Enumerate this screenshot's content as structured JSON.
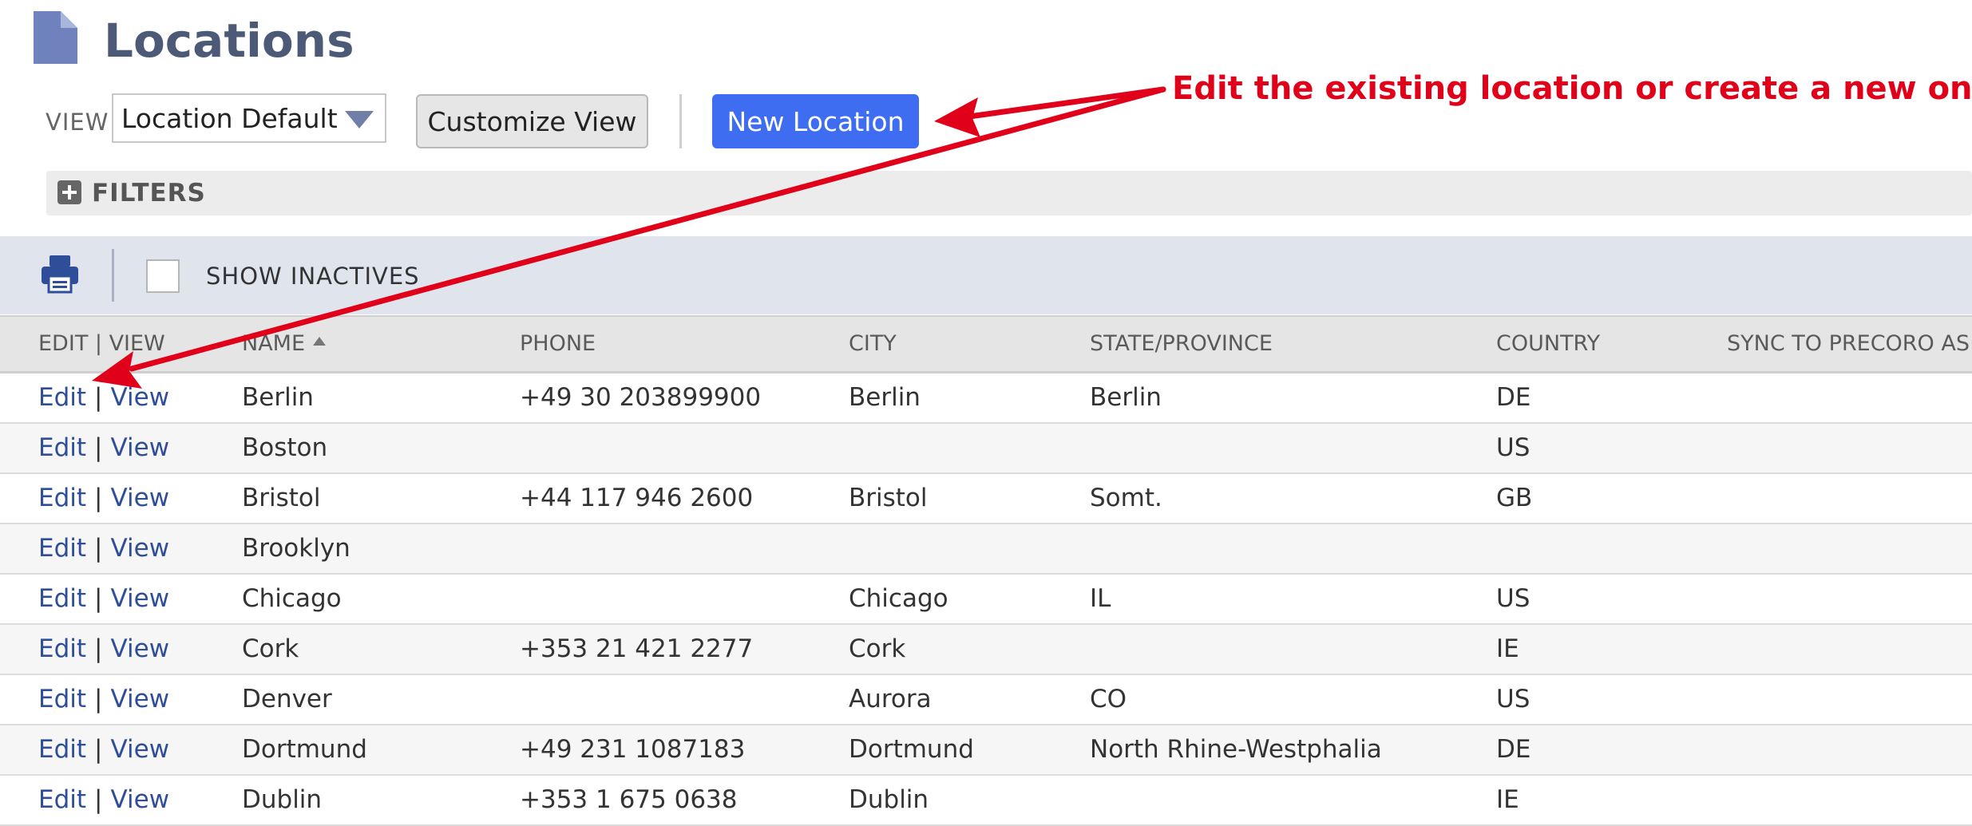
{
  "header": {
    "title": "Locations",
    "icon": "document-icon"
  },
  "toolbar": {
    "view_label": "VIEW",
    "view_value": "Location Default",
    "customize_label": "Customize View",
    "new_label": "New Location"
  },
  "filters": {
    "label": "FILTERS"
  },
  "list_toolbar": {
    "show_inactives_label": "SHOW INACTIVES",
    "show_inactives_checked": false
  },
  "columns": [
    "EDIT | VIEW",
    "NAME",
    "PHONE",
    "CITY",
    "STATE/PROVINCE",
    "COUNTRY",
    "SYNC TO PRECORO AS C"
  ],
  "sort": {
    "column": "NAME",
    "direction": "ascending"
  },
  "rows": [
    {
      "edit": "Edit",
      "sep": "|",
      "view": "View",
      "name": "Berlin",
      "phone": "+49 30 203899900",
      "city": "Berlin",
      "state": "Berlin",
      "country": "DE"
    },
    {
      "edit": "Edit",
      "sep": "|",
      "view": "View",
      "name": "Boston",
      "phone": "",
      "city": "",
      "state": "",
      "country": "US"
    },
    {
      "edit": "Edit",
      "sep": "|",
      "view": "View",
      "name": "Bristol",
      "phone": "+44 117 946 2600",
      "city": "Bristol",
      "state": "Somt.",
      "country": "GB"
    },
    {
      "edit": "Edit",
      "sep": "|",
      "view": "View",
      "name": "Brooklyn",
      "phone": "",
      "city": "",
      "state": "",
      "country": ""
    },
    {
      "edit": "Edit",
      "sep": "|",
      "view": "View",
      "name": "Chicago",
      "phone": "",
      "city": "Chicago",
      "state": "IL",
      "country": "US"
    },
    {
      "edit": "Edit",
      "sep": "|",
      "view": "View",
      "name": "Cork",
      "phone": "+353 21 421 2277",
      "city": "Cork",
      "state": "",
      "country": "IE"
    },
    {
      "edit": "Edit",
      "sep": "|",
      "view": "View",
      "name": "Denver",
      "phone": "",
      "city": "Aurora",
      "state": "CO",
      "country": "US"
    },
    {
      "edit": "Edit",
      "sep": "|",
      "view": "View",
      "name": "Dortmund",
      "phone": "+49 231 1087183",
      "city": "Dortmund",
      "state": "North Rhine-Westphalia",
      "country": "DE"
    },
    {
      "edit": "Edit",
      "sep": "|",
      "view": "View",
      "name": "Dublin",
      "phone": "+353 1 675 0638",
      "city": "Dublin",
      "state": "",
      "country": "IE"
    }
  ],
  "annotation": {
    "text": "Edit the existing location or create a new one",
    "color": "#e0001a"
  },
  "colors": {
    "accent": "#3f6df2",
    "title": "#4d5a77",
    "link": "#2f4e9a",
    "toolbar_bg": "#dfe4ed"
  }
}
